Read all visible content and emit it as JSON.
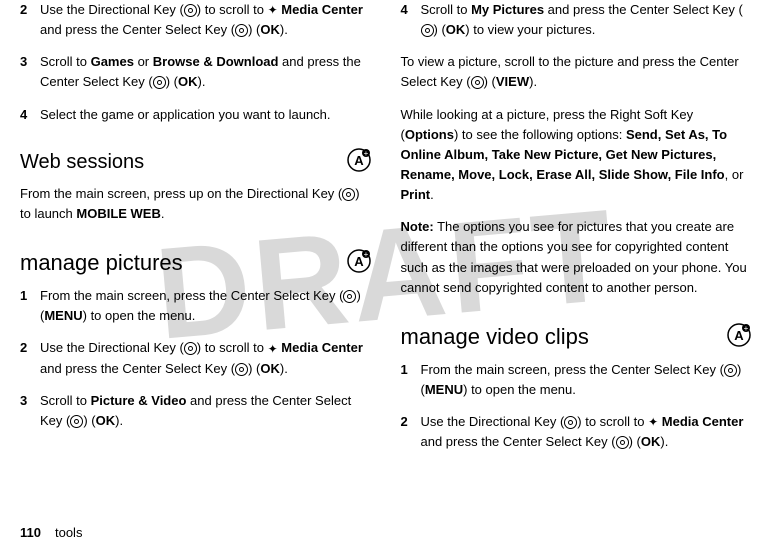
{
  "watermark": "DRAFT",
  "footer": {
    "page_number": "110",
    "section": "tools"
  },
  "icons": {
    "key": "center-key",
    "media": "✦",
    "badge": "A+"
  },
  "left": {
    "step2a_pre": "Use the Directional Key (",
    "step2a_mid": ") to scroll to ",
    "step2a_media": "Media Center",
    "step2a_mid2": " and press the Center Select Key (",
    "step2a_ok": "OK",
    "step2a_end": ").",
    "num2": "2",
    "step3a_pre": "Scroll to ",
    "step3a_b1": "Games",
    "step3a_mid": " or ",
    "step3a_b2": "Browse & Download",
    "step3a_mid2": " and press the Center Select Key (",
    "step3a_ok": "OK",
    "step3a_end": ").",
    "num3": "3",
    "step4a": "Select the game or application you want to launch.",
    "num4": "4",
    "h_web": "Web sessions",
    "web_p_pre": "From the main screen, press up on the Directional Key (",
    "web_p_mid": ") to launch ",
    "web_p_b": "MOBILE WEB",
    "web_p_end": ".",
    "h_pic": "manage pictures",
    "p1_pre": "From the main screen, press the Center Select Key (",
    "p1_b": "MENU",
    "p1_end": ") to open the menu.",
    "num1": "1",
    "p2_pre": "Use the Directional Key (",
    "p2_mid": ") to scroll to ",
    "p2_media": "Media Center",
    "p2_mid2": " and press the Center Select Key (",
    "p2_ok": "OK",
    "p2_end": ").",
    "p3_pre": "Scroll to ",
    "p3_b": "Picture & Video",
    "p3_mid": " and press the Center Select Key (",
    "p3_ok": "OK",
    "p3_end": ")."
  },
  "right": {
    "r4_pre": "Scroll to ",
    "r4_b": "My Pictures",
    "r4_mid": " and press the Center Select Key (",
    "r4_ok": "OK",
    "r4_end": ") to view your pictures.",
    "num4": "4",
    "rp1_pre": "To view a picture, scroll to the picture and press the Center Select Key (",
    "rp1_b": "VIEW",
    "rp1_end": ").",
    "rp2_pre": "While looking at a picture, press the Right Soft Key (",
    "rp2_opt": "Options",
    "rp2_mid": ") to see the following options: ",
    "rp2_list": "Send, Set As, To Online Album, Take New Picture, Get New Pictures, Rename, Move, Lock, Erase All, Slide Show, File Info",
    "rp2_or": ", or ",
    "rp2_last": "Print",
    "rp2_end": ".",
    "note_label": "Note:",
    "note_text": " The options you see for pictures that you create are different than the options you see for copyrighted content such as the images that were preloaded on your phone. You cannot send copyrighted content to another person.",
    "h_vid": "manage video clips",
    "v1_pre": "From the main screen, press the Center Select Key (",
    "v1_b": "MENU",
    "v1_end": ") to open the menu.",
    "num1": "1",
    "v2_pre": "Use the Directional Key (",
    "v2_mid": ") to scroll to ",
    "v2_media": "Media Center",
    "v2_mid2": " and press the Center Select Key (",
    "v2_ok": "OK",
    "v2_end": ").",
    "num2": "2"
  }
}
